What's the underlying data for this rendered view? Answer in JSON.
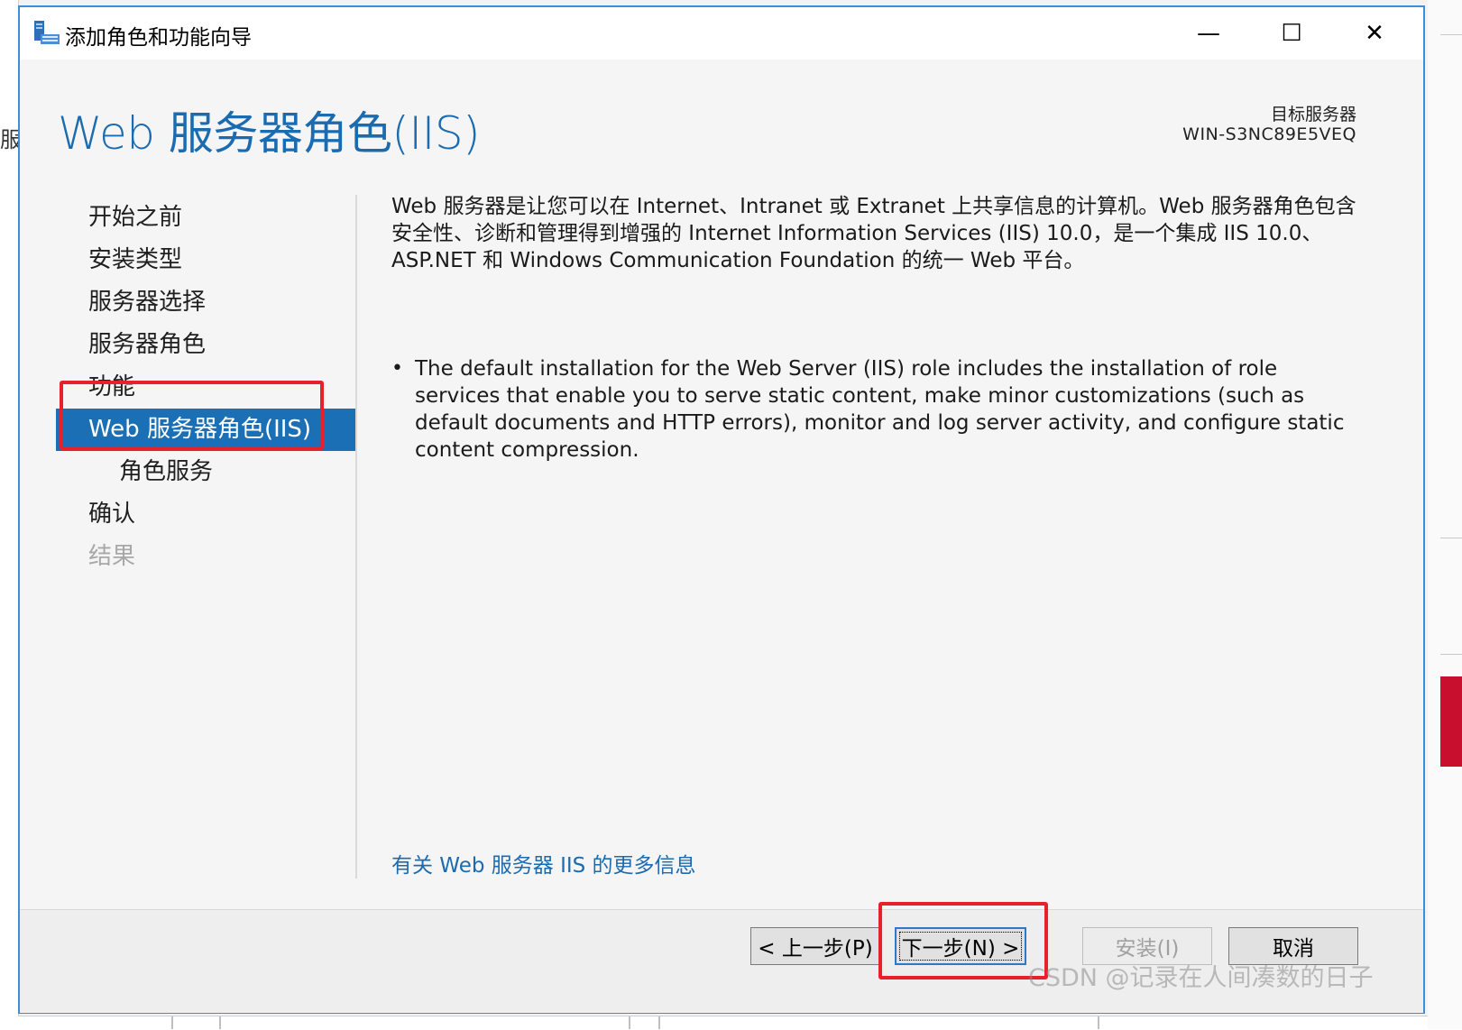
{
  "window": {
    "title": "添加角色和功能向导",
    "minimize_glyph": "—",
    "maximize_glyph": "☐",
    "close_glyph": "✕"
  },
  "background": {
    "left_fragment": "服务"
  },
  "page": {
    "title": "Web 服务器角色(IIS)",
    "target_label": "目标服务器",
    "target_name": "WIN-S3NC89E5VEQ"
  },
  "nav": {
    "items": [
      {
        "label": "开始之前",
        "state": "normal"
      },
      {
        "label": "安装类型",
        "state": "normal"
      },
      {
        "label": "服务器选择",
        "state": "normal"
      },
      {
        "label": "服务器角色",
        "state": "normal"
      },
      {
        "label": "功能",
        "state": "normal"
      },
      {
        "label": "Web 服务器角色(IIS)",
        "state": "active"
      },
      {
        "label": "角色服务",
        "state": "sub"
      },
      {
        "label": "确认",
        "state": "normal"
      },
      {
        "label": "结果",
        "state": "disabled"
      }
    ]
  },
  "content": {
    "description": "Web 服务器是让您可以在 Internet、Intranet 或 Extranet 上共享信息的计算机。Web 服务器角色包含安全性、诊断和管理得到增强的 Internet Information Services (IIS) 10.0，是一个集成 IIS 10.0、ASP.NET 和 Windows Communication Foundation 的统一 Web 平台。",
    "bullets": [
      "The default installation for the Web Server (IIS) role includes the installation of role services that enable you to serve static content, make minor customizations (such as default documents and HTTP errors), monitor and log server activity, and configure static content compression."
    ],
    "more_info_link": "有关 Web 服务器 IIS 的更多信息"
  },
  "buttons": {
    "back": "< 上一步(P)",
    "next": "下一步(N) >",
    "install": "安装(I)",
    "cancel": "取消"
  },
  "watermark": "CSDN @记录在人间凑数的日子",
  "colors": {
    "accent": "#1a6fb5",
    "title_blue": "#1b6bb0",
    "annotation_red": "#e8202b"
  }
}
